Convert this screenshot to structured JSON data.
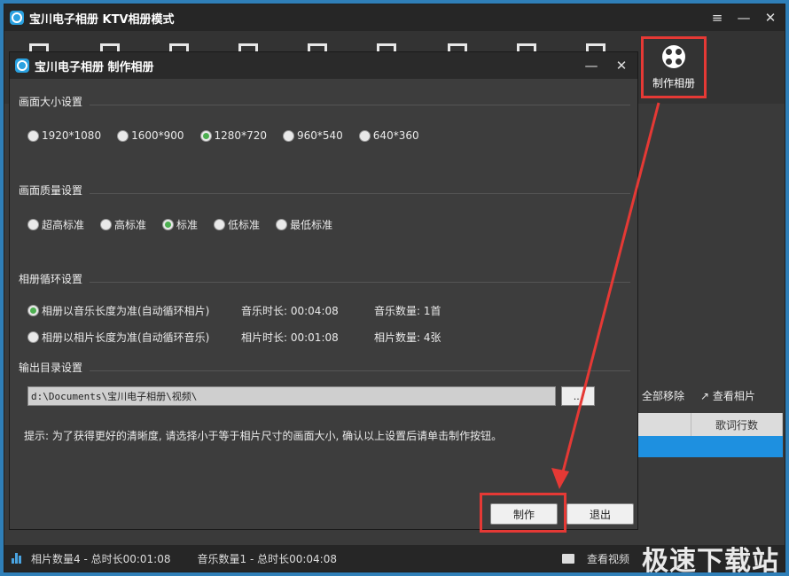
{
  "main": {
    "title": "宝川电子相册 KTV相册模式",
    "controls": {
      "menu": "≡",
      "minimize": "—",
      "close": "✕"
    }
  },
  "toolbar": {
    "make_album_label": "制作相册"
  },
  "right_panel": {
    "remove_all": "全部移除",
    "view_photos": "查看相片",
    "table_headers": [
      "歌词行数"
    ]
  },
  "statusbar": {
    "photo_info": "相片数量4 - 总时长00:01:08",
    "music_info": "音乐数量1 - 总时长00:04:08",
    "view_video": "查看视频",
    "watermark": "极速下载站"
  },
  "dialog": {
    "title": "宝川电子相册 制作相册",
    "controls": {
      "minimize": "—",
      "close": "✕"
    },
    "size_section": {
      "header": "画面大小设置",
      "options": [
        "1920*1080",
        "1600*900",
        "1280*720",
        "960*540",
        "640*360"
      ],
      "selected": "1280*720"
    },
    "quality_section": {
      "header": "画面质量设置",
      "options": [
        "超高标准",
        "高标准",
        "标准",
        "低标准",
        "最低标准"
      ],
      "selected": "标准"
    },
    "loop_section": {
      "header": "相册循环设置",
      "option_music": "相册以音乐长度为准(自动循环相片)",
      "option_photo": "相册以相片长度为准(自动循环音乐)",
      "music_duration": "音乐时长: 00:04:08",
      "music_count": "音乐数量: 1首",
      "photo_duration": "相片时长: 00:01:08",
      "photo_count": "相片数量: 4张",
      "selected": "music"
    },
    "output_section": {
      "header": "输出目录设置",
      "path": "d:\\Documents\\宝川电子相册\\视频\\",
      "browse": "..."
    },
    "hint": "提示: 为了获得更好的清晰度, 请选择小于等于相片尺寸的画面大小, 确认以上设置后请单击制作按钮。",
    "make_button": "制作",
    "exit_button": "退出"
  },
  "colors": {
    "accent_red": "#e53935",
    "radio_checked": "#4caf50",
    "selection_blue": "#1e90e0"
  }
}
